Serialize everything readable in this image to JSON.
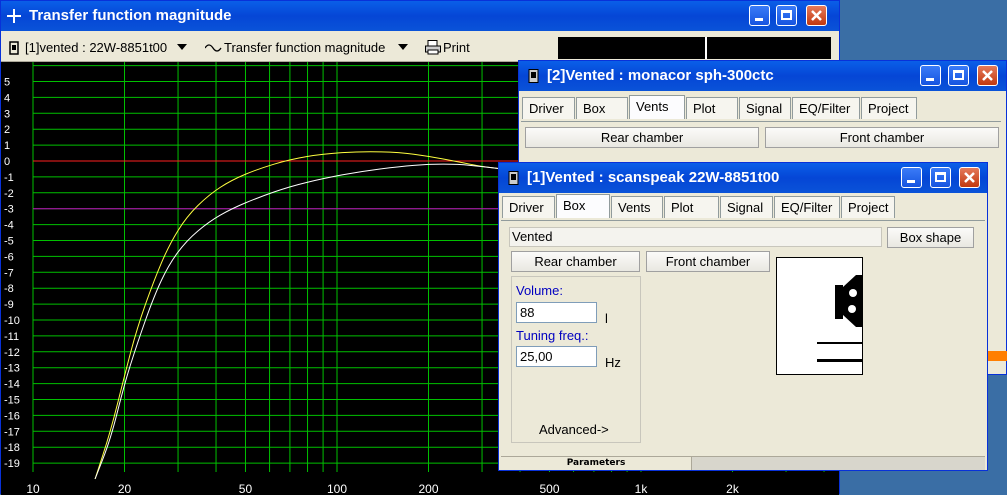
{
  "main_window": {
    "title": "Transfer function magnitude",
    "toolbar": {
      "system_select": "[1]vented : 22W-8851t00",
      "mode_select": "Transfer function magnitude",
      "print_label": "Print"
    }
  },
  "chart_data": {
    "type": "line",
    "x_scale": "log",
    "xlim": [
      10,
      20000
    ],
    "ylim": [
      -20,
      6
    ],
    "x_tick_labels": [
      "10",
      "20",
      "50",
      "100",
      "200",
      "500",
      "1k",
      "2k"
    ],
    "y_tick_labels": [
      "5",
      "4",
      "3",
      "2",
      "1",
      "0",
      "-1",
      "-2",
      "-3",
      "-4",
      "-5",
      "-6",
      "-7",
      "-8",
      "-9",
      "-10",
      "-11",
      "-12",
      "-13",
      "-14",
      "-15",
      "-16",
      "-17",
      "-18",
      "-19"
    ],
    "grid": true,
    "reference_lines": [
      {
        "y": 0,
        "color": "#ff2020"
      },
      {
        "y": -3,
        "color": "#c000c0"
      }
    ],
    "series": [
      {
        "color": "#ffff40",
        "points": [
          [
            16,
            -20
          ],
          [
            18,
            -17
          ],
          [
            20,
            -13.5
          ],
          [
            22,
            -10.5
          ],
          [
            25,
            -7.5
          ],
          [
            28,
            -5.3
          ],
          [
            32,
            -3.5
          ],
          [
            38,
            -2.1
          ],
          [
            45,
            -1.2
          ],
          [
            55,
            -0.5
          ],
          [
            70,
            0.1
          ],
          [
            90,
            0.45
          ],
          [
            120,
            0.6
          ],
          [
            160,
            0.55
          ],
          [
            200,
            0.3
          ],
          [
            250,
            -0.05
          ],
          [
            300,
            -0.35
          ],
          [
            350,
            -0.5
          ]
        ]
      },
      {
        "color": "#ffffff",
        "points": [
          [
            16,
            -20
          ],
          [
            18,
            -17.5
          ],
          [
            20,
            -14
          ],
          [
            22,
            -11.5
          ],
          [
            25,
            -8.5
          ],
          [
            28,
            -6.5
          ],
          [
            32,
            -5
          ],
          [
            38,
            -3.8
          ],
          [
            45,
            -3
          ],
          [
            55,
            -2.3
          ],
          [
            70,
            -1.6
          ],
          [
            90,
            -1.1
          ],
          [
            120,
            -0.65
          ],
          [
            160,
            -0.35
          ],
          [
            200,
            -0.2
          ],
          [
            250,
            -0.2
          ],
          [
            300,
            -0.35
          ],
          [
            350,
            -0.5
          ]
        ]
      }
    ]
  },
  "window2": {
    "title": "[2]Vented : monacor sph-300ctc",
    "tabs": [
      "Driver",
      "Box",
      "Vents",
      "Plot",
      "Signal",
      "EQ/Filter",
      "Project"
    ],
    "active_tab": "Vents",
    "rear_chamber": "Rear chamber",
    "front_chamber": "Front chamber"
  },
  "window1": {
    "title": "[1]Vented : scanspeak 22W-8851t00",
    "tabs": [
      "Driver",
      "Box",
      "Vents",
      "Plot",
      "Signal",
      "EQ/Filter",
      "Project"
    ],
    "active_tab": "Box",
    "box_type": "Vented",
    "box_shape_button": "Box shape",
    "rear_chamber": "Rear chamber",
    "front_chamber": "Front chamber",
    "volume_label": "Volume:",
    "volume_value": "88",
    "volume_unit": "l",
    "tuning_label": "Tuning freq.:",
    "tuning_value": "25,00",
    "tuning_unit": "Hz",
    "advanced_link": "Advanced->",
    "status_label": "Parameters"
  }
}
